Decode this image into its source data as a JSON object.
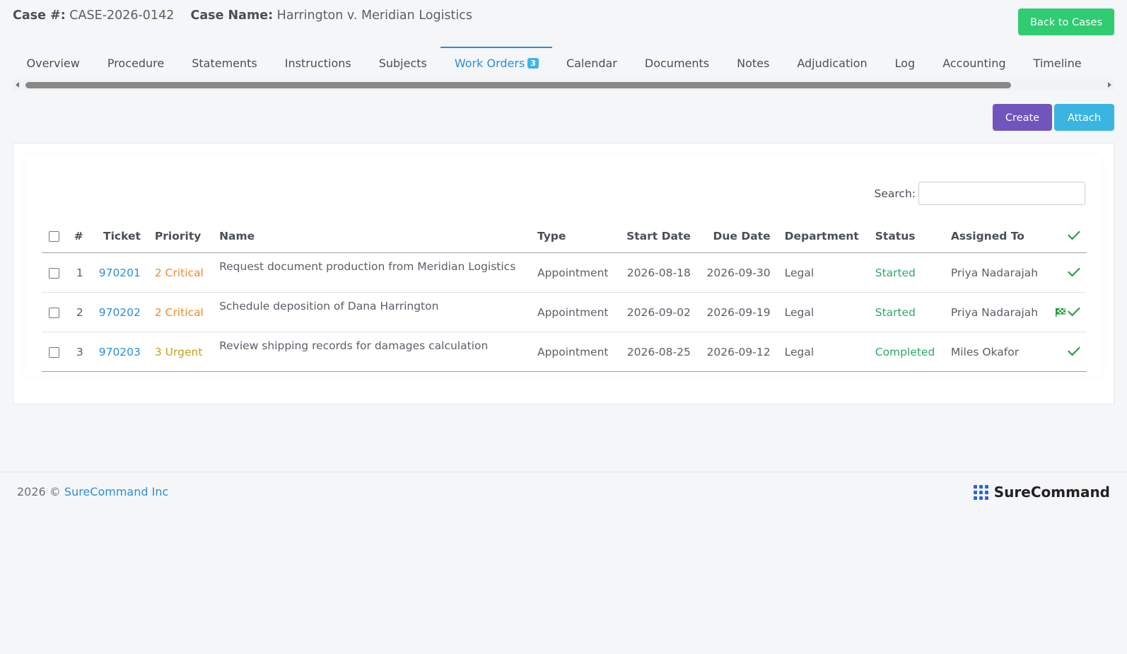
{
  "header": {
    "case_label": "Case #:",
    "case_number": "CASE-2026-0142",
    "case_name_label": "Case Name:",
    "case_name": "Harrington v. Meridian Logistics",
    "back_button": "Back to Cases"
  },
  "tabs": [
    {
      "label": "Overview"
    },
    {
      "label": "Procedure"
    },
    {
      "label": "Statements"
    },
    {
      "label": "Instructions"
    },
    {
      "label": "Subjects"
    },
    {
      "label": "Work Orders",
      "badge": "3",
      "active": true
    },
    {
      "label": "Calendar"
    },
    {
      "label": "Documents"
    },
    {
      "label": "Notes"
    },
    {
      "label": "Adjudication"
    },
    {
      "label": "Log"
    },
    {
      "label": "Accounting"
    },
    {
      "label": "Timeline"
    }
  ],
  "actions": {
    "create": "Create",
    "attach": "Attach"
  },
  "search": {
    "label": "Search:",
    "value": ""
  },
  "table": {
    "headers": {
      "num": "#",
      "ticket": "Ticket",
      "priority": "Priority",
      "name": "Name",
      "type": "Type",
      "start": "Start Date",
      "due": "Due Date",
      "department": "Department",
      "status": "Status",
      "assigned": "Assigned To"
    },
    "rows": [
      {
        "num": "1",
        "ticket": "970201",
        "priority": "2 Critical",
        "priority_level": "critical",
        "name": "Request document production from Meridian Logistics",
        "type": "Appointment",
        "start": "2026-08-18",
        "due": "2026-09-30",
        "department": "Legal",
        "status": "Started",
        "assigned": "Priya Nadarajah",
        "flag": false
      },
      {
        "num": "2",
        "ticket": "970202",
        "priority": "2 Critical",
        "priority_level": "critical",
        "name": "Schedule deposition of Dana Harrington",
        "type": "Appointment",
        "start": "2026-09-02",
        "due": "2026-09-19",
        "department": "Legal",
        "status": "Started",
        "assigned": "Priya Nadarajah",
        "flag": true
      },
      {
        "num": "3",
        "ticket": "970203",
        "priority": "3 Urgent",
        "priority_level": "urgent",
        "name": "Review shipping records for damages calculation",
        "type": "Appointment",
        "start": "2026-08-25",
        "due": "2026-09-12",
        "department": "Legal",
        "status": "Completed",
        "assigned": "Miles Okafor",
        "flag": false
      }
    ]
  },
  "footer": {
    "copyright": "2026 ©",
    "company_link": "SureCommand Inc",
    "brand": "SureCommand"
  },
  "colors": {
    "accent": "#2a8fd8",
    "back_button": "#2fcc71",
    "create_button": "#6f55bd",
    "attach_button": "#3ab5e1",
    "critical": "#ef8b2c",
    "urgent": "#c9a11a",
    "status": "#2aaa6a",
    "check": "#1e9b3a"
  }
}
